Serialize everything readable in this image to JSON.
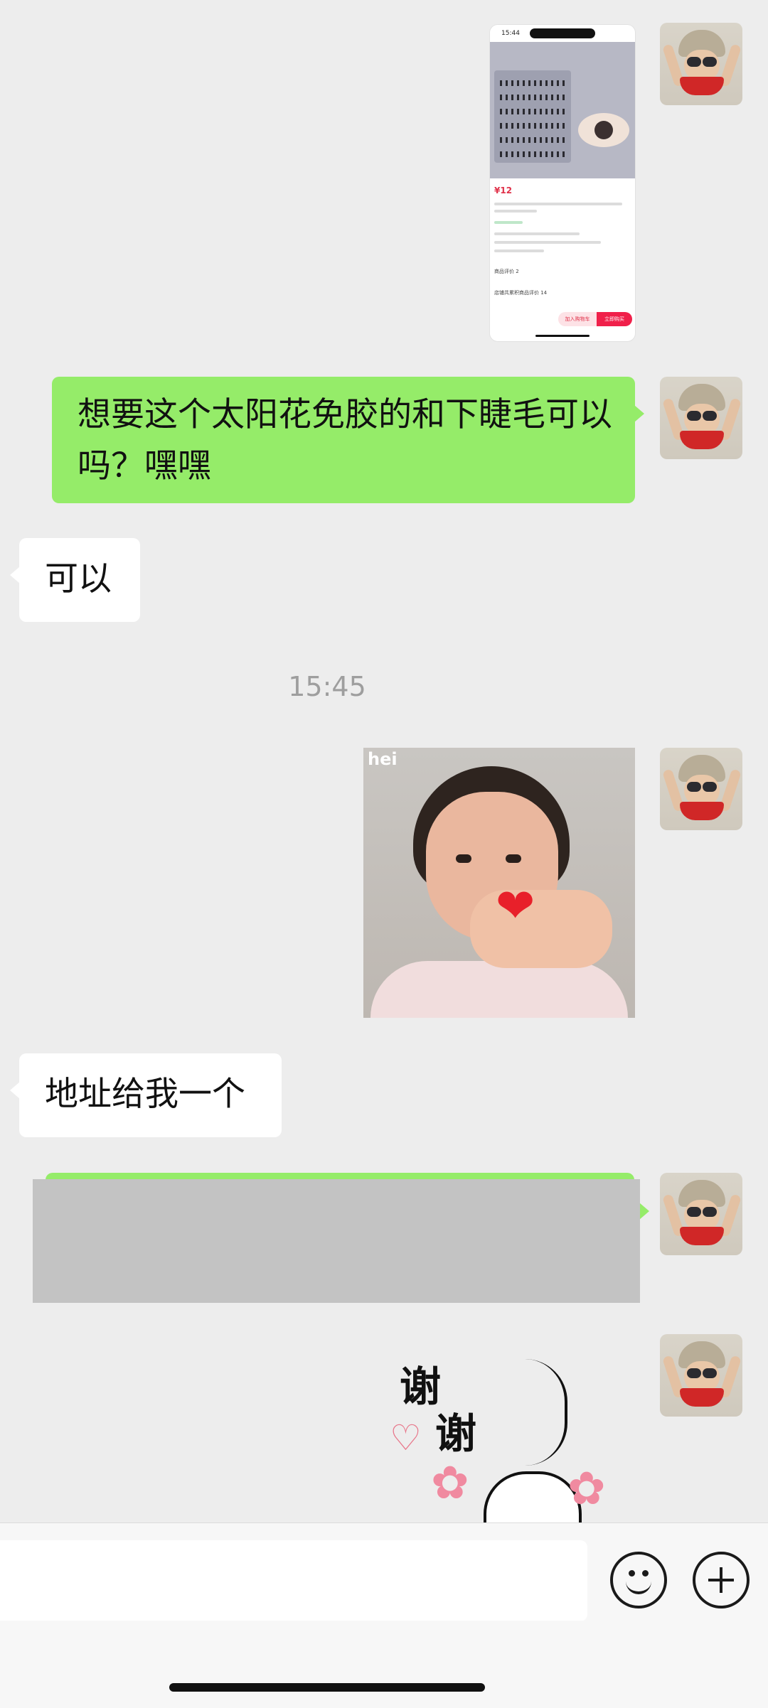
{
  "chat": {
    "messages": {
      "m1": {
        "kind": "image",
        "screenshot": {
          "time": "15:44",
          "price": "¥12",
          "shop_review_label": "店铺共累积商品评价 14",
          "product_review_label": "商品评价 2",
          "add_cart": "加入购物车",
          "buy_now": "立即购买"
        }
      },
      "m2": {
        "kind": "text",
        "side": "right",
        "text": "想要这个太阳花免胶的和下睫毛可以吗？嘿嘿"
      },
      "m3": {
        "kind": "text",
        "side": "left",
        "text": "可以"
      },
      "timestamp": "15:45",
      "m4": {
        "kind": "image",
        "caption": "hei"
      },
      "m5": {
        "kind": "text",
        "side": "left",
        "text": "地址给我一个"
      },
      "m6": {
        "kind": "redacted"
      },
      "m7": {
        "kind": "sticker",
        "line1": "谢",
        "line2": "谢"
      }
    }
  },
  "input_bar": {
    "text_value": "",
    "emoji_icon": "smiley-face-icon",
    "plus_icon": "plus-circle-icon"
  },
  "colors": {
    "background": "#ededed",
    "sent_bubble": "#95ec69",
    "received_bubble": "#ffffff",
    "timestamp": "#9e9e9e"
  }
}
